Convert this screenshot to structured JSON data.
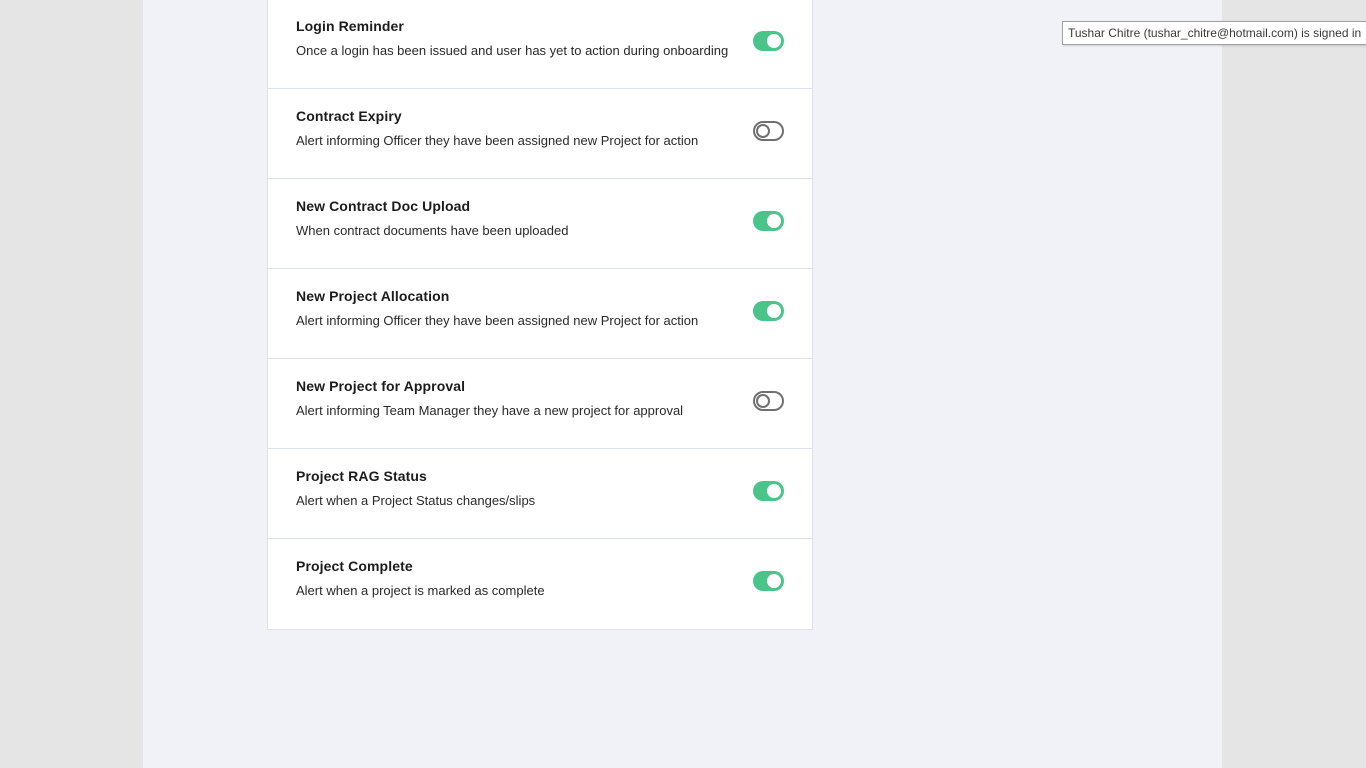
{
  "notifications": [
    {
      "title": "Login Reminder",
      "description": "Once a login has been issued and user has yet to action during onboarding",
      "enabled": true
    },
    {
      "title": "Contract Expiry",
      "description": "Alert informing Officer they have been assigned new Project for action",
      "enabled": false
    },
    {
      "title": "New Contract Doc Upload",
      "description": "When contract documents have been uploaded",
      "enabled": true
    },
    {
      "title": "New Project Allocation",
      "description": "Alert informing Officer they have been assigned new Project for action",
      "enabled": true
    },
    {
      "title": "New Project for Approval",
      "description": "Alert informing Team Manager they have a new project for approval",
      "enabled": false
    },
    {
      "title": "Project RAG Status",
      "description": "Alert when a Project Status changes/slips",
      "enabled": true
    },
    {
      "title": "Project Complete",
      "description": "Alert when a project is marked as complete",
      "enabled": true
    }
  ],
  "tooltip": {
    "text": "Tushar Chitre (tushar_chitre@hotmail.com) is signed in"
  },
  "colors": {
    "toggle_on": "#4bc48a",
    "toggle_off_border": "#707070",
    "page_background": "#f0f2f7",
    "outer_background": "#e5e5e5"
  }
}
